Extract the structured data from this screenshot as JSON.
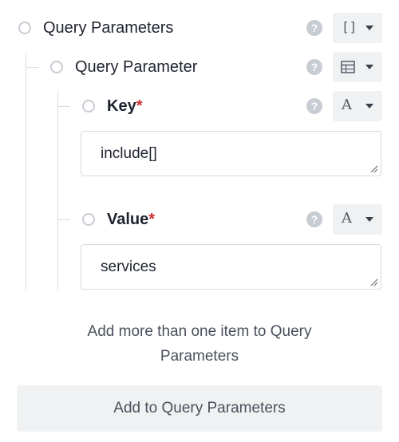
{
  "root_param": {
    "label": "Query Parameters",
    "type_icon": "array-brackets-icon",
    "type_glyph": "[]"
  },
  "param": {
    "label": "Query Parameter",
    "type_icon": "table-icon"
  },
  "key_field": {
    "label": "Key",
    "required_mark": "*",
    "type_icon": "text-type-icon",
    "type_glyph": "A",
    "value": "include[]"
  },
  "value_field": {
    "label": "Value",
    "required_mark": "*",
    "type_icon": "text-type-icon",
    "type_glyph": "A",
    "value": "services"
  },
  "help_glyph": "?",
  "hint": "Add more than one item to Query Parameters",
  "add_button": "Add to Query Parameters",
  "colors": {
    "required": "#cc2f2f",
    "button_bg": "#f0f1f3",
    "tree_line": "#d9dce1"
  }
}
